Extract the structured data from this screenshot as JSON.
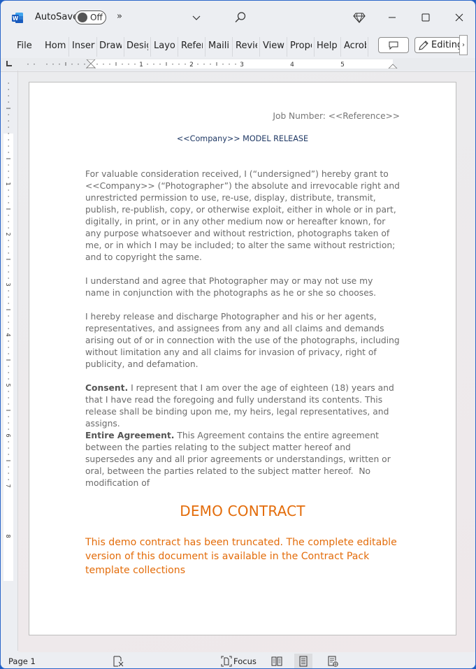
{
  "titlebar": {
    "app_icon": "word-logo-icon",
    "autosave_label": "AutoSave",
    "autosave_state": "Off",
    "more_commands": "»",
    "dropdown": "chevron-down-icon",
    "search": "search-icon",
    "premium": "diamond-icon",
    "window_controls": [
      "minimize-icon",
      "maximize-icon",
      "close-icon"
    ]
  },
  "ribbon": {
    "tabs": [
      {
        "label": "File"
      },
      {
        "label": "Home"
      },
      {
        "label": "Insert"
      },
      {
        "label": "Draw"
      },
      {
        "label": "Design"
      },
      {
        "label": "Layout"
      },
      {
        "label": "References"
      },
      {
        "label": "Mailings"
      },
      {
        "label": "Review"
      },
      {
        "label": "View"
      },
      {
        "label": "Properties"
      },
      {
        "label": "Help"
      },
      {
        "label": "Acrobat"
      }
    ],
    "comments_icon": "comment-icon",
    "editing_label": "Editing",
    "scroll_right": "›"
  },
  "ruler": {
    "horizontal_labels": [
      "1",
      "2",
      "3",
      "4",
      "5"
    ],
    "vertical_labels": [
      "1",
      "2",
      "3",
      "4",
      "5",
      "6",
      "7",
      "8"
    ]
  },
  "document": {
    "job_number": "Job Number: <<Reference>>",
    "title": "<<Company>> MODEL RELEASE",
    "paragraphs": [
      {
        "bold": "",
        "text": "For valuable consideration received, I (“undersigned”) hereby grant to <<Company>> (“Photographer”) the absolute and irrevocable right and unrestricted permission to use, re-use, display, distribute, transmit, publish, re-publish, copy, or otherwise exploit, either in whole or in part, digitally, in print, or in any other medium now or hereafter known, for any purpose whatsoever and without restriction, photographs taken of me, or in which I may be included; to alter the same without restriction; and to copyright the same."
      },
      {
        "bold": "",
        "text": "I understand and agree that Photographer may or may not use my name in conjunction with the photographs as he or she so chooses."
      },
      {
        "bold": "",
        "text": "I hereby release and discharge Photographer and his or her agents, representatives, and assignees from any and all claims and demands arising out of or in connection with the use of the photographs, including without limitation any and all claims for invasion of privacy, right of publicity, and defamation."
      },
      {
        "bold": "Consent.",
        "text": " I represent that I am over the age of eighteen (18) years and that I have read the foregoing and fully understand its contents. This release shall be binding upon me, my heirs, legal representatives, and assigns."
      },
      {
        "bold": "Entire Agreement.",
        "text": " This Agreement contains the entire agreement between the parties relating to the subject matter hereof and supersedes any and all prior agreements or understandings, written or oral, between the parties related to the subject matter hereof.  No modification of"
      }
    ],
    "demo_title": "DEMO CONTRACT",
    "demo_text": "This demo contract has been truncated. The complete editable version of this document is available in the Contract Pack template collections",
    "accent_color": "#e36c0a",
    "title_color": "#1f3864"
  },
  "statusbar": {
    "page": "Page 1",
    "proofing_icon": "proofing-icon",
    "focus_label": "Focus",
    "views": [
      "read-mode-icon",
      "print-layout-icon",
      "web-layout-icon"
    ],
    "active_view": "print-layout"
  }
}
